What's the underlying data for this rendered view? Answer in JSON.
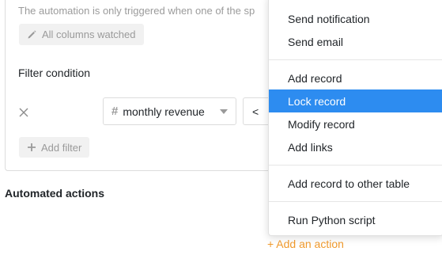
{
  "trigger": {
    "hint_text": "The automation is only triggered when one of the sp",
    "watched_button_label": "All columns watched",
    "filter_title": "Filter condition",
    "filter": {
      "column_label": "monthly revenue",
      "column_type_icon": "hash-icon",
      "operator_label": "<"
    },
    "add_filter_label": "Add filter"
  },
  "actions": {
    "section_title": "Automated actions",
    "add_action_label": "+ Add an action"
  },
  "menu": {
    "items": [
      {
        "label": "Send notification"
      },
      {
        "label": "Send email"
      },
      {
        "label": "Add record"
      },
      {
        "label": "Lock record",
        "selected": true
      },
      {
        "label": "Modify record"
      },
      {
        "label": "Add links"
      },
      {
        "label": "Add record to other table"
      },
      {
        "label": "Run Python script"
      }
    ]
  },
  "colors": {
    "selected": "#2d8cf0",
    "accent_link": "#f09a2d",
    "muted": "#9a9a9a"
  }
}
